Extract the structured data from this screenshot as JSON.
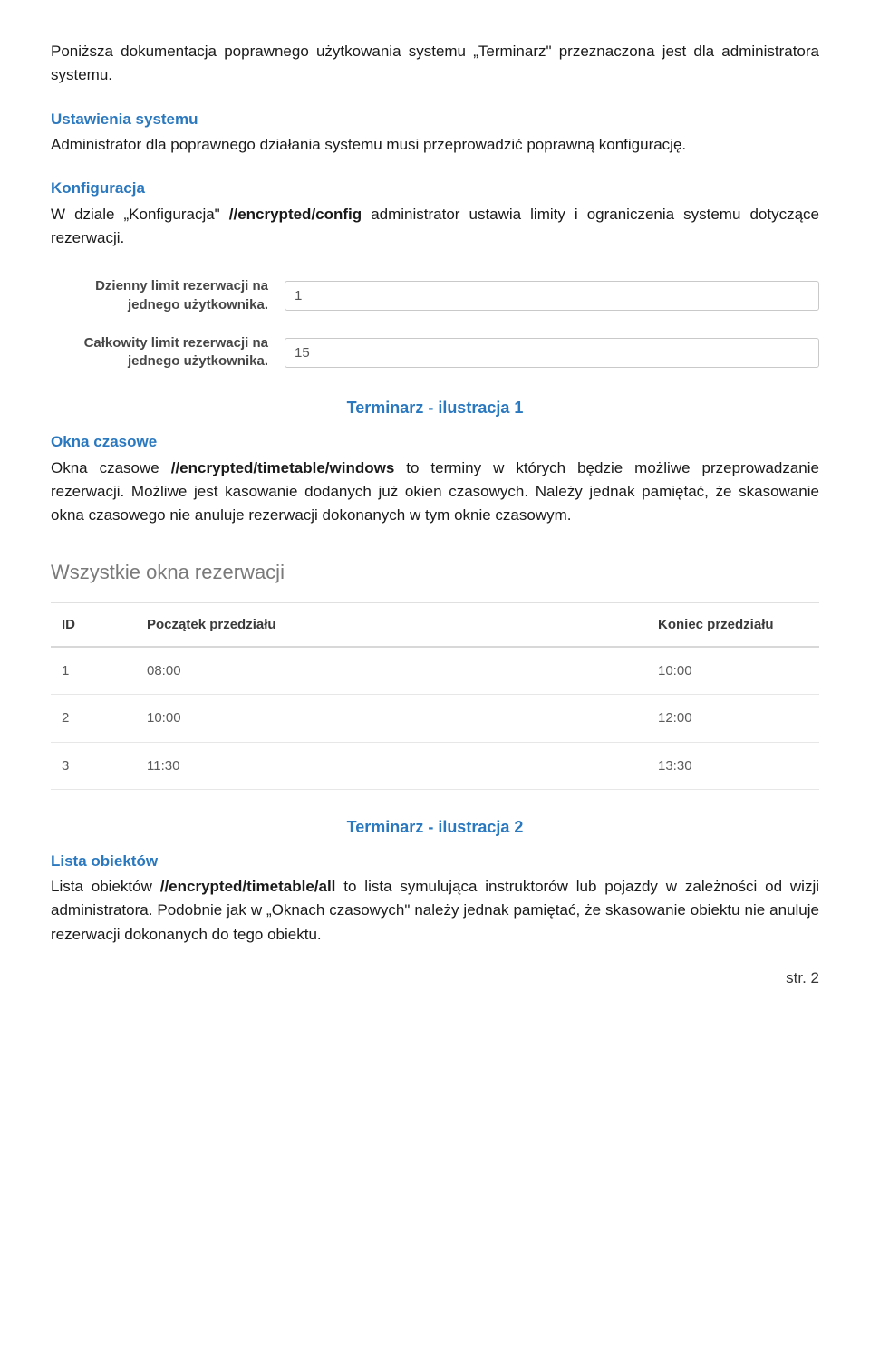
{
  "intro": "Poniższa dokumentacja poprawnego użytkowania systemu „Terminarz\" przeznaczona jest dla administratora systemu.",
  "sec1": {
    "heading": "Ustawienia systemu",
    "body": "Administrator dla poprawnego działania systemu musi przeprowadzić poprawną konfigurację."
  },
  "sec2": {
    "heading": "Konfiguracja",
    "body_pre": "W dziale „Konfiguracja\" ",
    "body_bold": "//encrypted/config",
    "body_post": " administrator ustawia limity i ograniczenia systemu dotyczące rezerwacji."
  },
  "ill1": {
    "rows": [
      {
        "label": "Dzienny limit rezerwacji na jednego użytkownika.",
        "value": "1"
      },
      {
        "label": "Całkowity limit rezerwacji na jednego użytkownika.",
        "value": "15"
      }
    ]
  },
  "caption1": "Terminarz - ilustracja 1",
  "sec3": {
    "heading": "Okna czasowe",
    "body_pre": "Okna czasowe ",
    "body_bold": "//encrypted/timetable/windows",
    "body_post": "  to terminy w których będzie możliwe przeprowadzanie rezerwacji. Możliwe jest kasowanie dodanych już okien czasowych. Należy jednak pamiętać, że skasowanie okna czasowego nie anuluje rezerwacji dokonanych w tym oknie czasowym."
  },
  "ill2": {
    "title": "Wszystkie okna rezerwacji",
    "columns": [
      "ID",
      "Początek przedziału",
      "Koniec przedziału"
    ],
    "rows": [
      {
        "id": "1",
        "start": "08:00",
        "end": "10:00"
      },
      {
        "id": "2",
        "start": "10:00",
        "end": "12:00"
      },
      {
        "id": "3",
        "start": "11:30",
        "end": "13:30"
      }
    ]
  },
  "caption2": "Terminarz - ilustracja 2",
  "sec4": {
    "heading": "Lista obiektów",
    "body_pre": "Lista obiektów ",
    "body_bold": "//encrypted/timetable/all",
    "body_post": " to lista symulująca instruktorów lub pojazdy w zależności od wizji administratora. Podobnie jak w „Oknach czasowych\" należy jednak pamiętać, że skasowanie obiektu nie anuluje rezerwacji dokonanych do tego obiektu."
  },
  "page_footer": "str. 2"
}
